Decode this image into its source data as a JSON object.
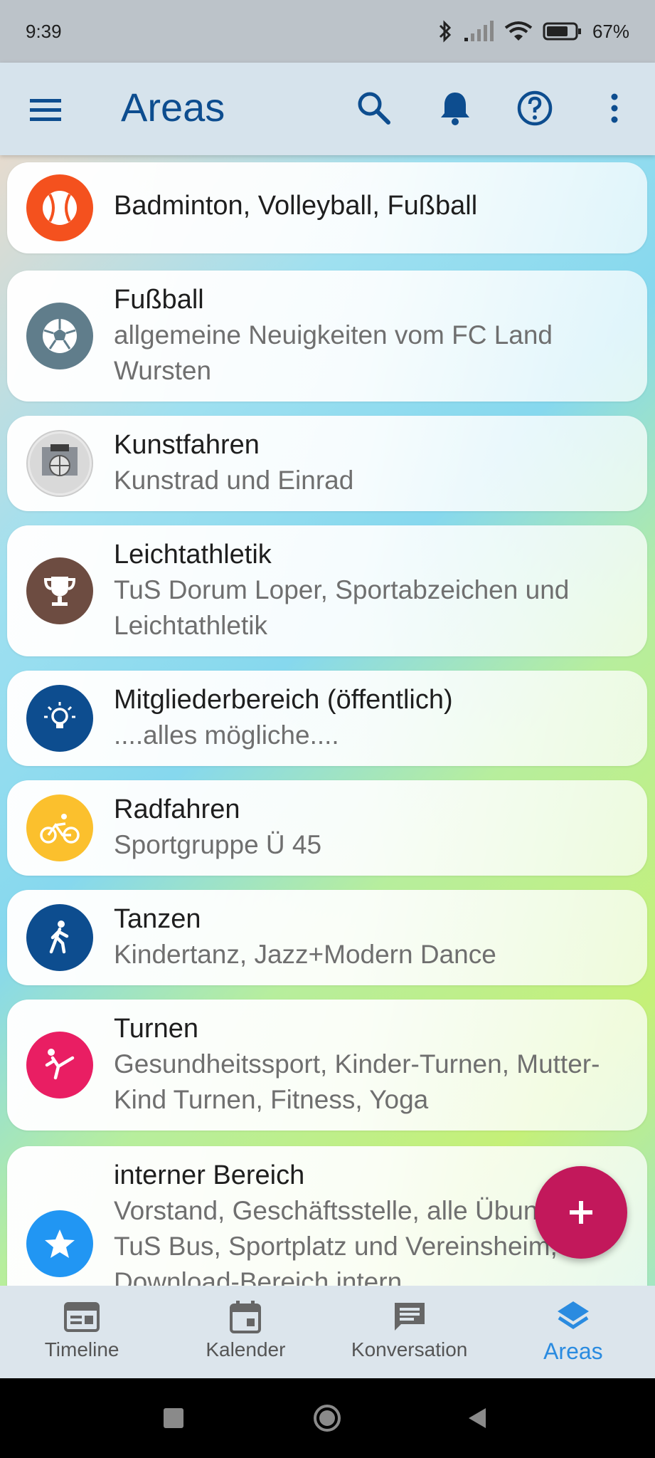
{
  "status": {
    "time": "9:39",
    "battery": "67%"
  },
  "appbar": {
    "title": "Areas"
  },
  "areas": [
    {
      "title": "Badminton, Volleyball, Fußball",
      "subtitle": "",
      "icon": "baseball-icon",
      "color": "#f4511e"
    },
    {
      "title": "Fußball",
      "subtitle": "allgemeine Neuigkeiten vom FC Land Wursten",
      "icon": "soccer-icon",
      "color": "#607d8b"
    },
    {
      "title": "Kunstfahren",
      "subtitle": "Kunstrad und Einrad",
      "icon": "photo-avatar",
      "color": "#9e9e9e"
    },
    {
      "title": "Leichtathletik",
      "subtitle": "TuS Dorum Loper, Sportabzeichen und Leichtathletik",
      "icon": "trophy-icon",
      "color": "#6d4c41"
    },
    {
      "title": "Mitgliederbereich (öffentlich)",
      "subtitle": "....alles mögliche....",
      "icon": "lightbulb-icon",
      "color": "#0d4d8f"
    },
    {
      "title": "Radfahren",
      "subtitle": "Sportgruppe Ü 45",
      "icon": "bike-icon",
      "color": "#fbc02d"
    },
    {
      "title": "Tanzen",
      "subtitle": "Kindertanz, Jazz+Modern Dance",
      "icon": "walking-icon",
      "color": "#0d4d8f"
    },
    {
      "title": "Turnen",
      "subtitle": "Gesundheitssport, Kinder-Turnen, Mutter-Kind Turnen, Fitness, Yoga",
      "icon": "martial-arts-icon",
      "color": "#e91e63"
    },
    {
      "title": "interner Bereich",
      "subtitle": "Vorstand, Geschäftsstelle, alle Übungsleiter, TuS Bus, Sportplatz und Vereinsheim, Download-Bereich intern",
      "icon": "star-icon",
      "color": "#2196f3"
    }
  ],
  "nav": {
    "timeline": "Timeline",
    "kalender": "Kalender",
    "konversation": "Konversation",
    "areas": "Areas"
  },
  "colors": {
    "primary": "#0d4d8f",
    "accent": "#c2185b",
    "active_nav": "#2a8be0"
  }
}
